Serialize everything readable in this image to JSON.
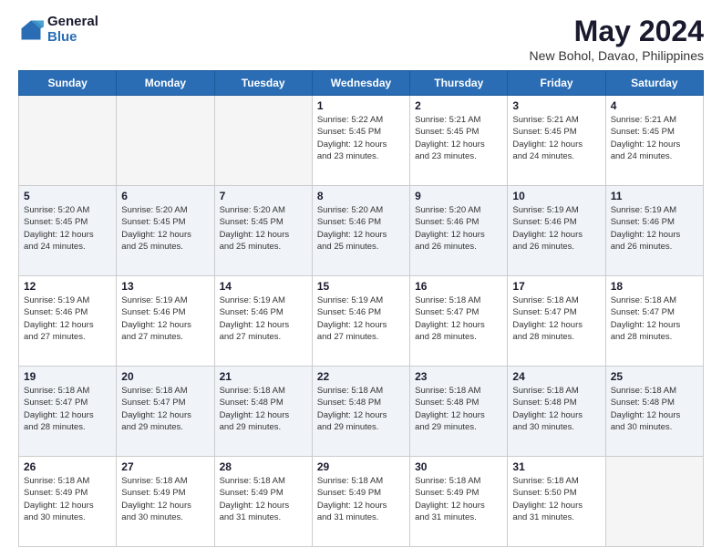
{
  "header": {
    "logo_general": "General",
    "logo_blue": "Blue",
    "title": "May 2024",
    "subtitle": "New Bohol, Davao, Philippines"
  },
  "days_of_week": [
    "Sunday",
    "Monday",
    "Tuesday",
    "Wednesday",
    "Thursday",
    "Friday",
    "Saturday"
  ],
  "weeks": [
    {
      "days": [
        {
          "num": "",
          "info": ""
        },
        {
          "num": "",
          "info": ""
        },
        {
          "num": "",
          "info": ""
        },
        {
          "num": "1",
          "info": "Sunrise: 5:22 AM\nSunset: 5:45 PM\nDaylight: 12 hours\nand 23 minutes."
        },
        {
          "num": "2",
          "info": "Sunrise: 5:21 AM\nSunset: 5:45 PM\nDaylight: 12 hours\nand 23 minutes."
        },
        {
          "num": "3",
          "info": "Sunrise: 5:21 AM\nSunset: 5:45 PM\nDaylight: 12 hours\nand 24 minutes."
        },
        {
          "num": "4",
          "info": "Sunrise: 5:21 AM\nSunset: 5:45 PM\nDaylight: 12 hours\nand 24 minutes."
        }
      ]
    },
    {
      "days": [
        {
          "num": "5",
          "info": "Sunrise: 5:20 AM\nSunset: 5:45 PM\nDaylight: 12 hours\nand 24 minutes."
        },
        {
          "num": "6",
          "info": "Sunrise: 5:20 AM\nSunset: 5:45 PM\nDaylight: 12 hours\nand 25 minutes."
        },
        {
          "num": "7",
          "info": "Sunrise: 5:20 AM\nSunset: 5:45 PM\nDaylight: 12 hours\nand 25 minutes."
        },
        {
          "num": "8",
          "info": "Sunrise: 5:20 AM\nSunset: 5:46 PM\nDaylight: 12 hours\nand 25 minutes."
        },
        {
          "num": "9",
          "info": "Sunrise: 5:20 AM\nSunset: 5:46 PM\nDaylight: 12 hours\nand 26 minutes."
        },
        {
          "num": "10",
          "info": "Sunrise: 5:19 AM\nSunset: 5:46 PM\nDaylight: 12 hours\nand 26 minutes."
        },
        {
          "num": "11",
          "info": "Sunrise: 5:19 AM\nSunset: 5:46 PM\nDaylight: 12 hours\nand 26 minutes."
        }
      ]
    },
    {
      "days": [
        {
          "num": "12",
          "info": "Sunrise: 5:19 AM\nSunset: 5:46 PM\nDaylight: 12 hours\nand 27 minutes."
        },
        {
          "num": "13",
          "info": "Sunrise: 5:19 AM\nSunset: 5:46 PM\nDaylight: 12 hours\nand 27 minutes."
        },
        {
          "num": "14",
          "info": "Sunrise: 5:19 AM\nSunset: 5:46 PM\nDaylight: 12 hours\nand 27 minutes."
        },
        {
          "num": "15",
          "info": "Sunrise: 5:19 AM\nSunset: 5:46 PM\nDaylight: 12 hours\nand 27 minutes."
        },
        {
          "num": "16",
          "info": "Sunrise: 5:18 AM\nSunset: 5:47 PM\nDaylight: 12 hours\nand 28 minutes."
        },
        {
          "num": "17",
          "info": "Sunrise: 5:18 AM\nSunset: 5:47 PM\nDaylight: 12 hours\nand 28 minutes."
        },
        {
          "num": "18",
          "info": "Sunrise: 5:18 AM\nSunset: 5:47 PM\nDaylight: 12 hours\nand 28 minutes."
        }
      ]
    },
    {
      "days": [
        {
          "num": "19",
          "info": "Sunrise: 5:18 AM\nSunset: 5:47 PM\nDaylight: 12 hours\nand 28 minutes."
        },
        {
          "num": "20",
          "info": "Sunrise: 5:18 AM\nSunset: 5:47 PM\nDaylight: 12 hours\nand 29 minutes."
        },
        {
          "num": "21",
          "info": "Sunrise: 5:18 AM\nSunset: 5:48 PM\nDaylight: 12 hours\nand 29 minutes."
        },
        {
          "num": "22",
          "info": "Sunrise: 5:18 AM\nSunset: 5:48 PM\nDaylight: 12 hours\nand 29 minutes."
        },
        {
          "num": "23",
          "info": "Sunrise: 5:18 AM\nSunset: 5:48 PM\nDaylight: 12 hours\nand 29 minutes."
        },
        {
          "num": "24",
          "info": "Sunrise: 5:18 AM\nSunset: 5:48 PM\nDaylight: 12 hours\nand 30 minutes."
        },
        {
          "num": "25",
          "info": "Sunrise: 5:18 AM\nSunset: 5:48 PM\nDaylight: 12 hours\nand 30 minutes."
        }
      ]
    },
    {
      "days": [
        {
          "num": "26",
          "info": "Sunrise: 5:18 AM\nSunset: 5:49 PM\nDaylight: 12 hours\nand 30 minutes."
        },
        {
          "num": "27",
          "info": "Sunrise: 5:18 AM\nSunset: 5:49 PM\nDaylight: 12 hours\nand 30 minutes."
        },
        {
          "num": "28",
          "info": "Sunrise: 5:18 AM\nSunset: 5:49 PM\nDaylight: 12 hours\nand 31 minutes."
        },
        {
          "num": "29",
          "info": "Sunrise: 5:18 AM\nSunset: 5:49 PM\nDaylight: 12 hours\nand 31 minutes."
        },
        {
          "num": "30",
          "info": "Sunrise: 5:18 AM\nSunset: 5:49 PM\nDaylight: 12 hours\nand 31 minutes."
        },
        {
          "num": "31",
          "info": "Sunrise: 5:18 AM\nSunset: 5:50 PM\nDaylight: 12 hours\nand 31 minutes."
        },
        {
          "num": "",
          "info": ""
        }
      ]
    }
  ]
}
